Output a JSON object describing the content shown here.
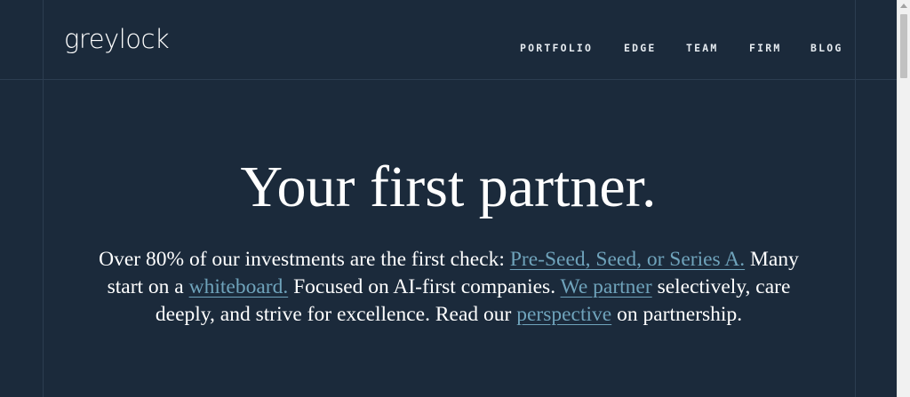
{
  "brand": {
    "logo_text": "greylock"
  },
  "nav": {
    "items": [
      {
        "label": "PORTFOLIO"
      },
      {
        "label": "EDGE"
      },
      {
        "label": "TEAM"
      },
      {
        "label": "FIRM"
      },
      {
        "label": "BLOG"
      }
    ]
  },
  "hero": {
    "title": "Your first partner.",
    "text_1": "Over 80% of our investments are the first check: ",
    "link_stages": "Pre-Seed, Seed, or Series A.",
    "text_2": " Many start on a ",
    "link_whiteboard": "whiteboard.",
    "text_3": " Focused on AI-first companies. ",
    "link_partner": "We partner",
    "text_4": " selectively, care deeply, and strive for excellence. Read our ",
    "link_perspective": "perspective",
    "text_5": " on partnership."
  },
  "colors": {
    "background": "#1b2a3b",
    "link": "#6fa3bb",
    "text": "#ffffff"
  }
}
